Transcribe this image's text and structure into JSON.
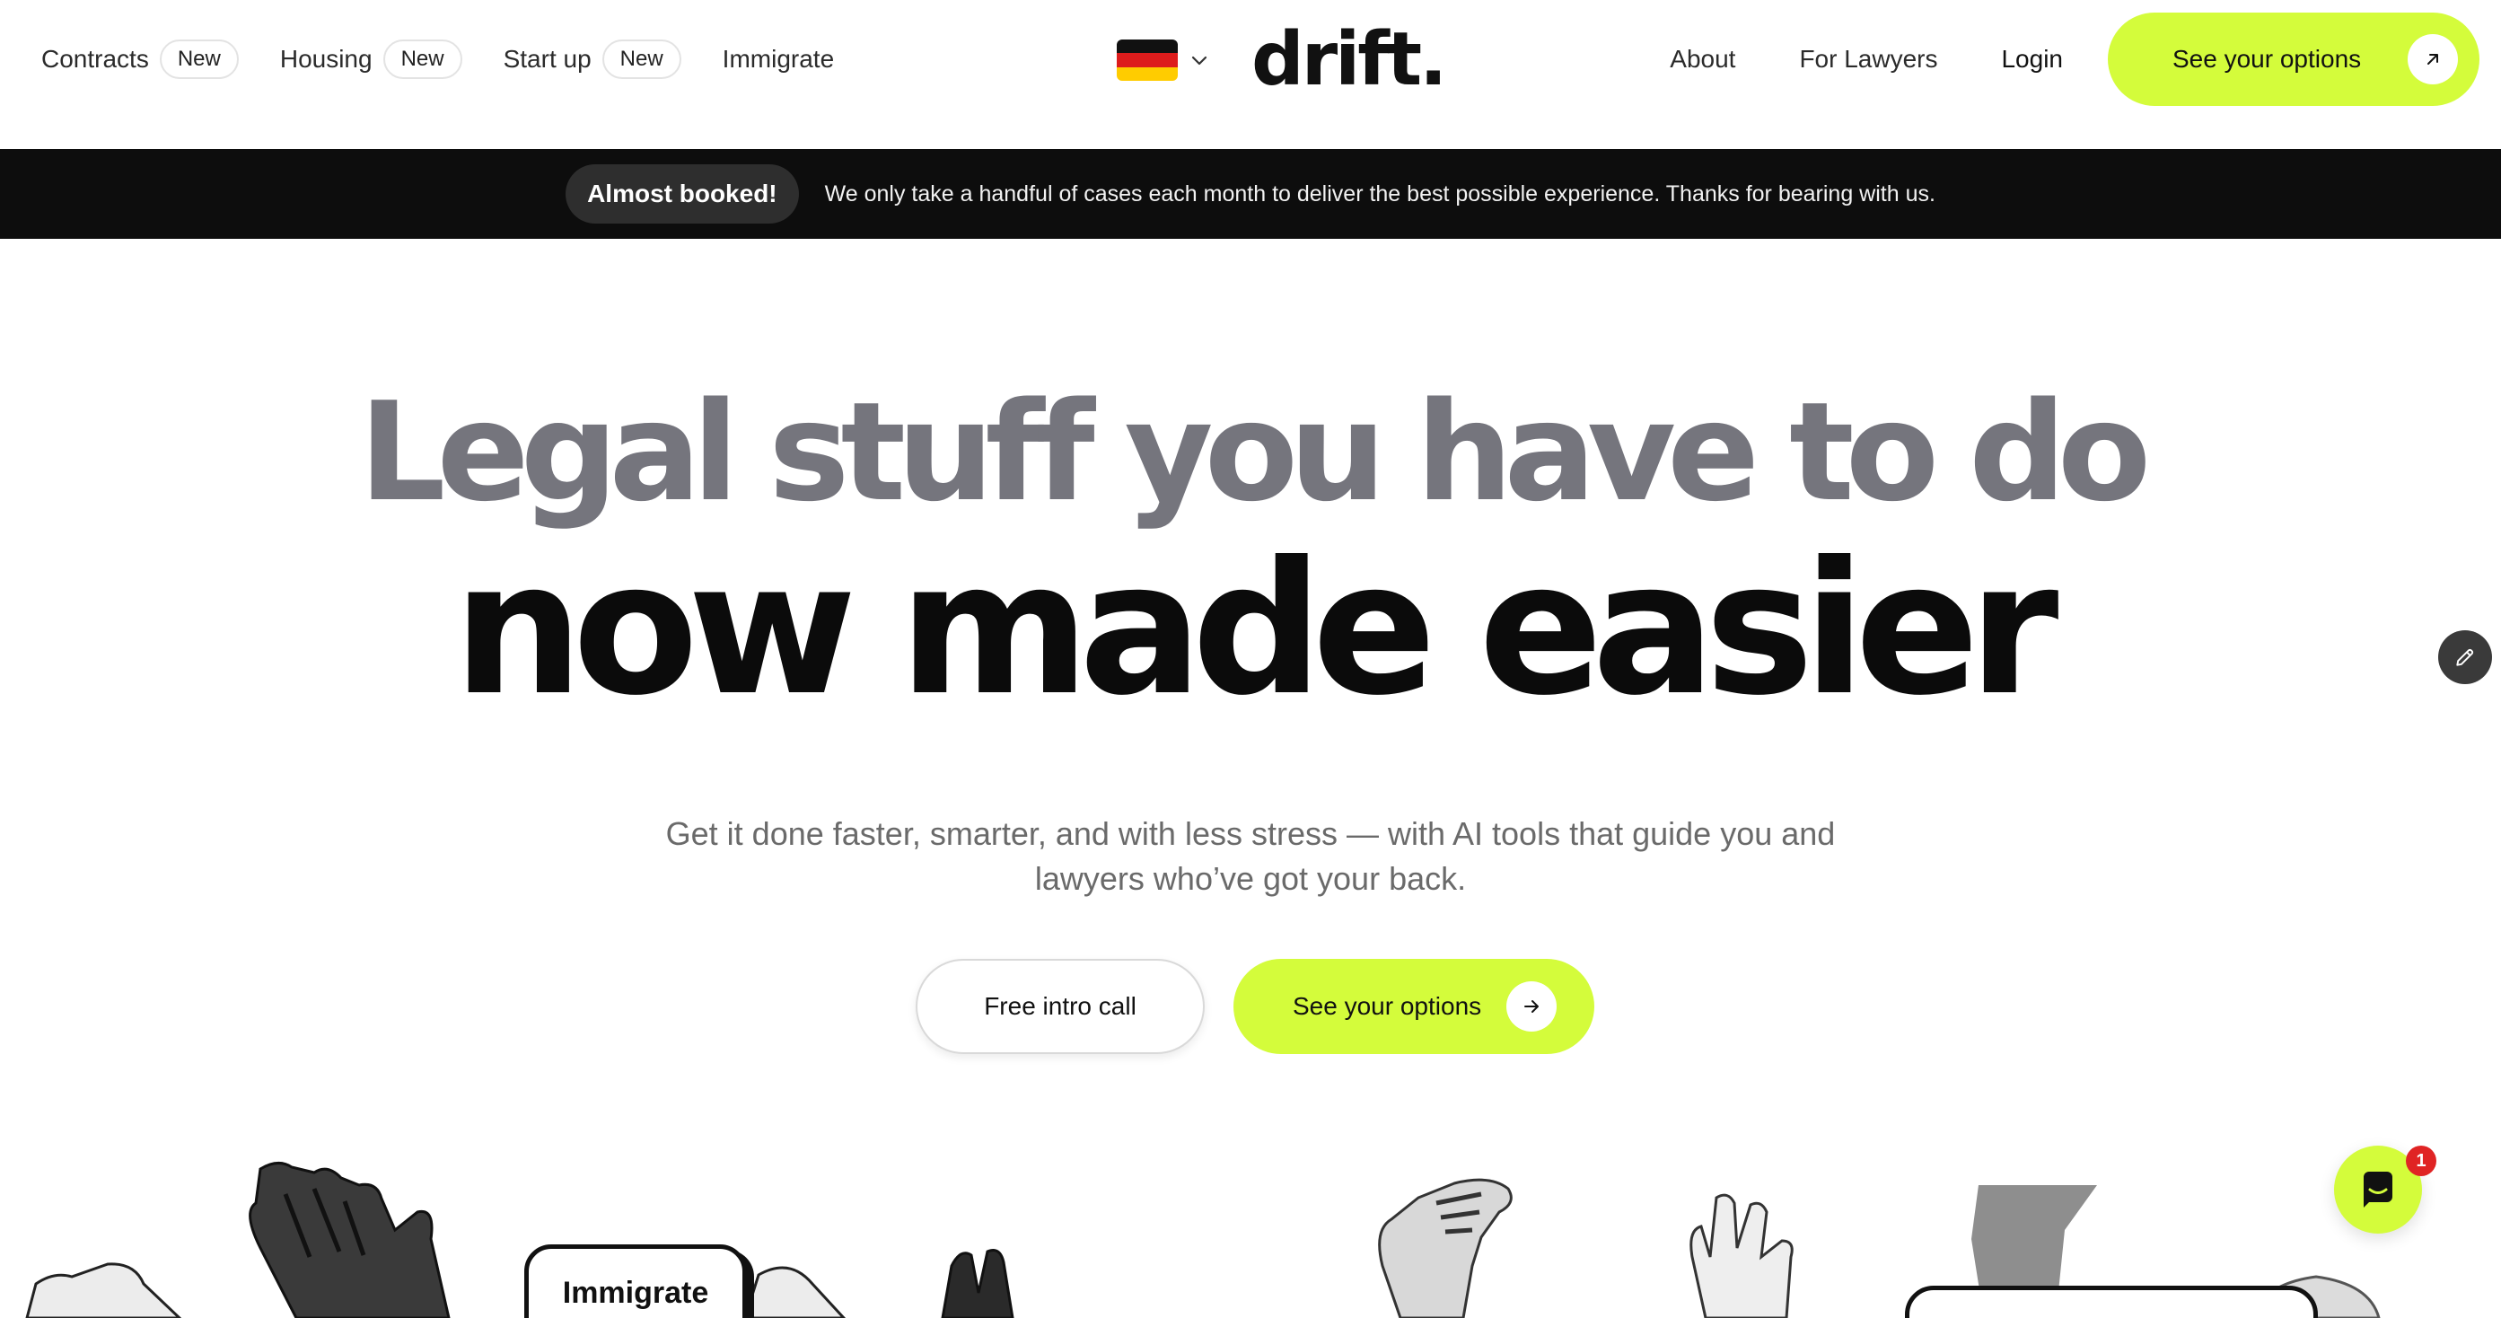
{
  "header": {
    "nav_left": [
      {
        "label": "Contracts",
        "badge": "New"
      },
      {
        "label": "Housing",
        "badge": "New"
      },
      {
        "label": "Start up",
        "badge": "New"
      },
      {
        "label": "Immigrate"
      }
    ],
    "language_flag": "flag-germany-icon",
    "logo": "drift.",
    "nav_right": {
      "about": "About",
      "for_lawyers": "For Lawyers",
      "login": "Login",
      "cta": "See your options"
    }
  },
  "banner": {
    "badge": "Almost booked!",
    "text": "We only take a handful of cases each month to deliver the best possible experience. Thanks for bearing with us."
  },
  "hero": {
    "title_line1": "Legal stuff you have to do",
    "title_line2": "now made easier",
    "subtitle": "Get it done faster, smarter, and with less stress — with AI tools that guide you and lawyers who’ve got your back.",
    "secondary_button": "Free intro call",
    "primary_button": "See your options"
  },
  "illustrations": {
    "card_label": "Immigrate"
  },
  "chat": {
    "unread_count": "1"
  },
  "colors": {
    "accent": "#d4fc3b",
    "banner_bg": "#0d0d0d",
    "title_gray": "#75757d",
    "title_dark": "#0b0b0b",
    "badge_red": "#e02424"
  }
}
